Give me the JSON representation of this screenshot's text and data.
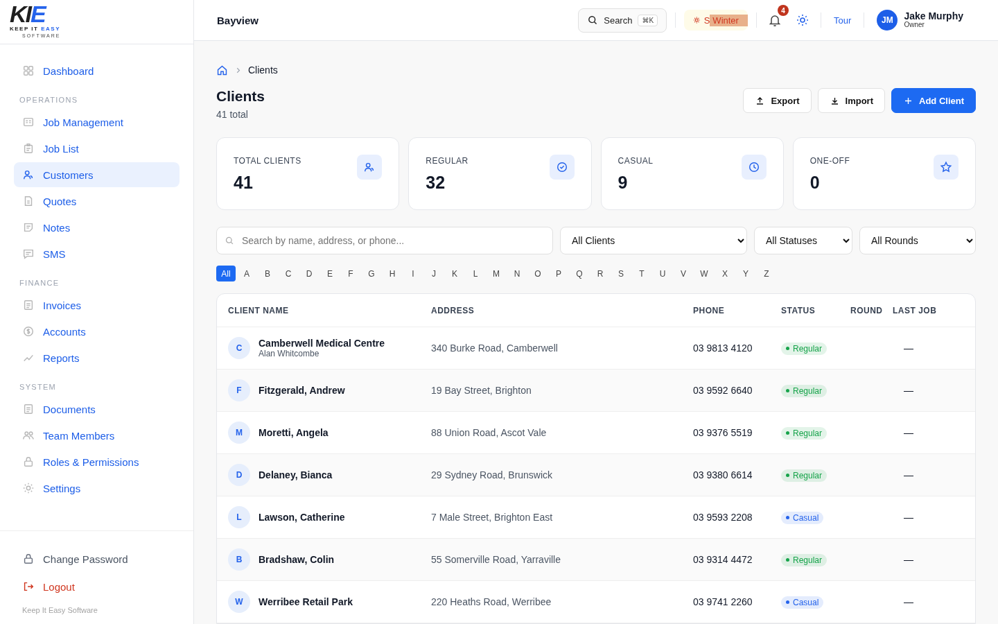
{
  "logo": {
    "mark_dark": "KI",
    "mark_accent": "E",
    "tagline_dark": "KEEP IT",
    "tagline_accent": "EASY",
    "sub": "SOFTWARE"
  },
  "sidebar": {
    "top": [
      {
        "label": "Dashboard",
        "selected": false
      }
    ],
    "sections": [
      {
        "heading": "OPERATIONS",
        "items": [
          {
            "label": "Job Management",
            "selected": false
          },
          {
            "label": "Job List",
            "selected": false
          },
          {
            "label": "Customers",
            "selected": true
          },
          {
            "label": "Quotes",
            "selected": false
          },
          {
            "label": "Notes",
            "selected": false
          },
          {
            "label": "SMS",
            "selected": false
          }
        ]
      },
      {
        "heading": "FINANCE",
        "items": [
          {
            "label": "Invoices",
            "selected": false
          },
          {
            "label": "Accounts",
            "selected": false
          },
          {
            "label": "Reports",
            "selected": false
          }
        ]
      },
      {
        "heading": "SYSTEM",
        "items": [
          {
            "label": "Documents",
            "selected": false
          },
          {
            "label": "Team Members",
            "selected": false
          },
          {
            "label": "Roles & Permissions",
            "selected": false
          },
          {
            "label": "Settings",
            "selected": false
          }
        ]
      }
    ],
    "change_password": "Change Password",
    "logout": "Logout",
    "footer": "Keep It Easy Software"
  },
  "topbar": {
    "title": "Bayview",
    "search": "Search",
    "shortcut": "⌘K",
    "season_under": "S",
    "season": "Winter",
    "notifications": "4",
    "tour": "Tour",
    "user": {
      "initials": "JM",
      "name": "Jake Murphy",
      "role": "Owner"
    }
  },
  "breadcrumb": [
    "Clients"
  ],
  "page": {
    "title": "Clients",
    "subtitle": "41 total",
    "buttons": [
      {
        "label": "Export",
        "kind": "export"
      },
      {
        "label": "Import",
        "kind": "import"
      },
      {
        "label": "Add Client",
        "kind": "add"
      }
    ]
  },
  "stats": [
    {
      "label": "TOTAL CLIENTS",
      "value": "41"
    },
    {
      "label": "REGULAR",
      "value": "32"
    },
    {
      "label": "CASUAL",
      "value": "9"
    },
    {
      "label": "ONE-OFF",
      "value": "0"
    }
  ],
  "filters": {
    "search_placeholder": "Search by name, address, or phone...",
    "selects": [
      "All Clients",
      "All Statuses",
      "All Rounds"
    ]
  },
  "letters": [
    {
      "label": "All",
      "selected": true
    },
    {
      "label": "A",
      "selected": false
    },
    {
      "label": "B",
      "selected": false
    },
    {
      "label": "C",
      "selected": false
    },
    {
      "label": "D",
      "selected": false
    },
    {
      "label": "E",
      "selected": false
    },
    {
      "label": "F",
      "selected": false
    },
    {
      "label": "G",
      "selected": false
    },
    {
      "label": "H",
      "selected": false
    },
    {
      "label": "I",
      "selected": false
    },
    {
      "label": "J",
      "selected": false
    },
    {
      "label": "K",
      "selected": false
    },
    {
      "label": "L",
      "selected": false
    },
    {
      "label": "M",
      "selected": false
    },
    {
      "label": "N",
      "selected": false
    },
    {
      "label": "O",
      "selected": false
    },
    {
      "label": "P",
      "selected": false
    },
    {
      "label": "Q",
      "selected": false
    },
    {
      "label": "R",
      "selected": false
    },
    {
      "label": "S",
      "selected": false
    },
    {
      "label": "T",
      "selected": false
    },
    {
      "label": "U",
      "selected": false
    },
    {
      "label": "V",
      "selected": false
    },
    {
      "label": "W",
      "selected": false
    },
    {
      "label": "X",
      "selected": false
    },
    {
      "label": "Y",
      "selected": false
    },
    {
      "label": "Z",
      "selected": false
    }
  ],
  "table": {
    "columns": [
      "CLIENT NAME",
      "ADDRESS",
      "PHONE",
      "STATUS",
      "ROUND",
      "LAST JOB"
    ],
    "rows": [
      {
        "initial": "C",
        "name": "Camberwell Medical Centre",
        "contact": "Alan Whitcombe",
        "address": "340 Burke Road, Camberwell",
        "phone": "03 9813 4120",
        "status": "Regular",
        "color": "#16a34a",
        "last_job": "—"
      },
      {
        "initial": "F",
        "name": "Fitzgerald, Andrew",
        "address": "19 Bay Street, Brighton",
        "phone": "03 9592 6640",
        "status": "Regular",
        "color": "#16a34a",
        "last_job": "—"
      },
      {
        "initial": "M",
        "name": "Moretti, Angela",
        "address": "88 Union Road, Ascot Vale",
        "phone": "03 9376 5519",
        "status": "Regular",
        "color": "#16a34a",
        "last_job": "—"
      },
      {
        "initial": "D",
        "name": "Delaney, Bianca",
        "address": "29 Sydney Road, Brunswick",
        "phone": "03 9380 6614",
        "status": "Regular",
        "color": "#16a34a",
        "last_job": "—"
      },
      {
        "initial": "L",
        "name": "Lawson, Catherine",
        "address": "7 Male Street, Brighton East",
        "phone": "03 9593 2208",
        "status": "Casual",
        "color": "#2563eb",
        "last_job": "—"
      },
      {
        "initial": "B",
        "name": "Bradshaw, Colin",
        "address": "55 Somerville Road, Yarraville",
        "phone": "03 9314 4472",
        "status": "Regular",
        "color": "#16a34a",
        "last_job": "—"
      },
      {
        "initial": "W",
        "name": "Werribee Retail Park",
        "address": "220 Heaths Road, Werribee",
        "phone": "03 9741 2260",
        "status": "Casual",
        "color": "#2563eb",
        "last_job": "—"
      }
    ]
  }
}
